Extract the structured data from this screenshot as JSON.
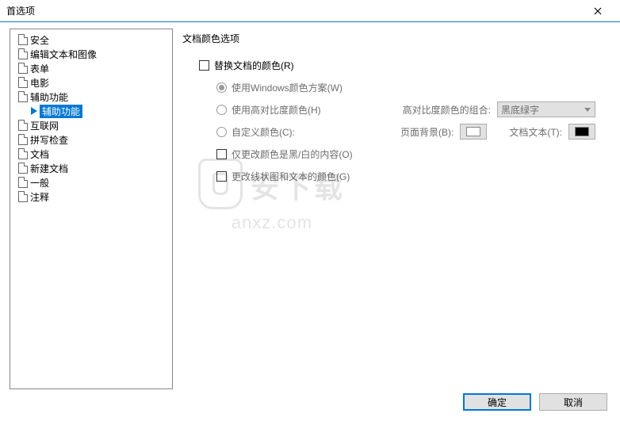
{
  "window": {
    "title": "首选项"
  },
  "sidebar": {
    "items": [
      {
        "label": "安全"
      },
      {
        "label": "编辑文本和图像"
      },
      {
        "label": "表单"
      },
      {
        "label": "电影"
      },
      {
        "label": "辅助功能"
      },
      {
        "label": "辅助功能",
        "sub": true,
        "selected": true
      },
      {
        "label": "互联网"
      },
      {
        "label": "拼写检查"
      },
      {
        "label": "文档"
      },
      {
        "label": "新建文档"
      },
      {
        "label": "一般"
      },
      {
        "label": "注释"
      }
    ]
  },
  "main": {
    "group_title": "文档颜色选项",
    "replace_colors": "替换文档的颜色(R)",
    "opt_windows": "使用Windows颜色方案(W)",
    "opt_high_contrast": "使用高对比度颜色(H)",
    "high_contrast_combo_label": "高对比度颜色的组合:",
    "high_contrast_value": "黑底绿字",
    "opt_custom": "自定义颜色(C):",
    "page_bg_label": "页面背景(B):",
    "doc_text_label": "文档文本(T):",
    "only_bw": "仅更改颜色是黑/白的内容(O)",
    "change_lines": "更改线状图和文本的颜色(G)"
  },
  "buttons": {
    "ok": "确定",
    "cancel": "取消"
  },
  "watermark": {
    "cn": "安下载",
    "en": "anxz.com"
  }
}
